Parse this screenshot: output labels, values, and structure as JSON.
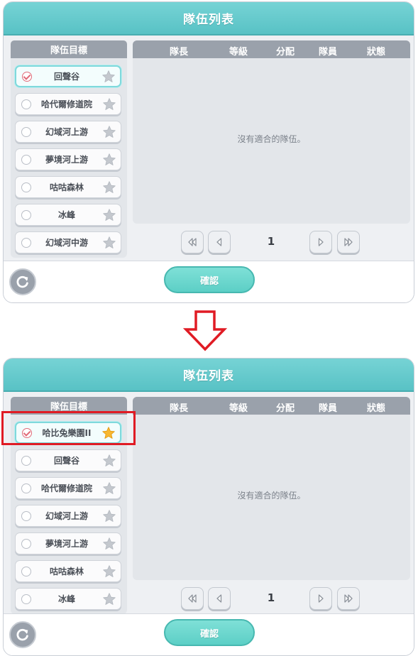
{
  "title": "隊伍列表",
  "left_header": "隊伍目標",
  "columns": [
    "隊長",
    "等級",
    "分配",
    "隊員",
    "狀態"
  ],
  "empty_message": "沒有適合的隊伍。",
  "page_number": "1",
  "confirm_label": "確認",
  "colors": {
    "accent": "#5ec7c9",
    "header_gray": "#9aa1ab",
    "star_active": "#f7b731",
    "highlight": "#e01b24"
  },
  "icons": [
    "check-icon",
    "star-icon",
    "first-page-icon",
    "prev-page-icon",
    "next-page-icon",
    "last-page-icon",
    "refresh-icon",
    "down-arrow-icon"
  ],
  "top_panel": {
    "targets": [
      {
        "label": "回聲谷",
        "selected": true,
        "starred": false
      },
      {
        "label": "哈代爾修道院",
        "selected": false,
        "starred": false
      },
      {
        "label": "幻域河上游",
        "selected": false,
        "starred": false
      },
      {
        "label": "夢境河上游",
        "selected": false,
        "starred": false
      },
      {
        "label": "咕咕森林",
        "selected": false,
        "starred": false
      },
      {
        "label": "冰峰",
        "selected": false,
        "starred": false
      },
      {
        "label": "幻域河中游",
        "selected": false,
        "starred": false
      }
    ]
  },
  "bottom_panel": {
    "targets": [
      {
        "label": "哈比兔樂園II",
        "selected": true,
        "starred": true
      },
      {
        "label": "回聲谷",
        "selected": false,
        "starred": false
      },
      {
        "label": "哈代爾修道院",
        "selected": false,
        "starred": false
      },
      {
        "label": "幻域河上游",
        "selected": false,
        "starred": false
      },
      {
        "label": "夢境河上游",
        "selected": false,
        "starred": false
      },
      {
        "label": "咕咕森林",
        "selected": false,
        "starred": false
      },
      {
        "label": "冰峰",
        "selected": false,
        "starred": false
      }
    ]
  }
}
